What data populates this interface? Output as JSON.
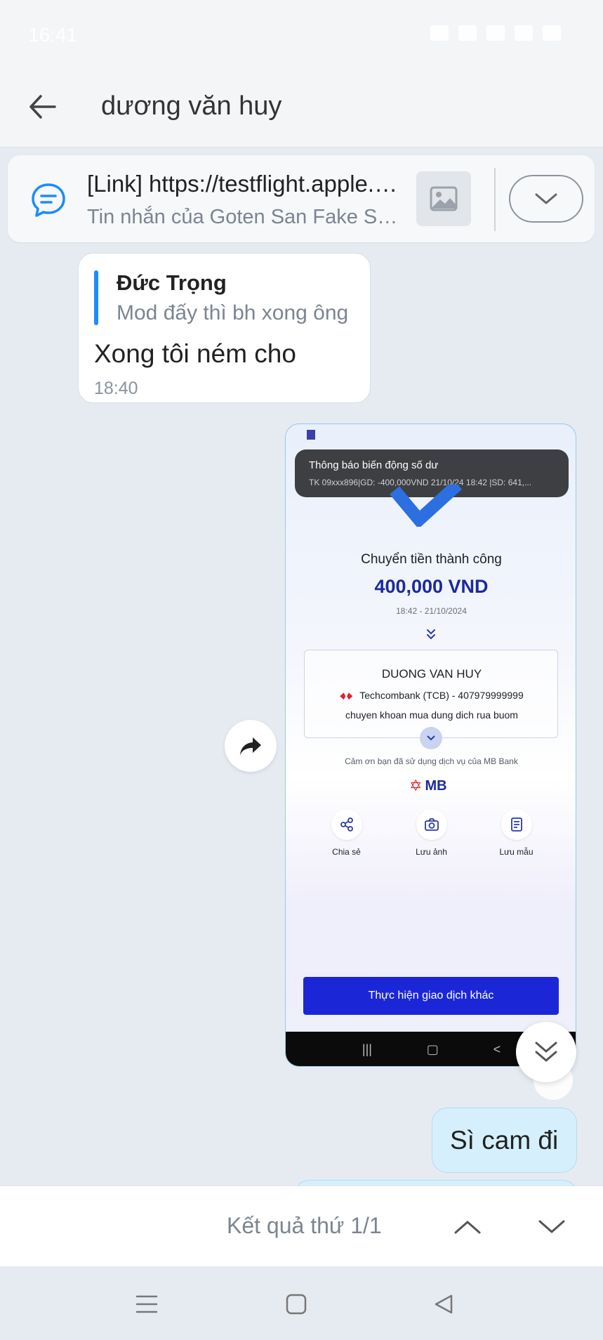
{
  "status_bar": {
    "time": "16:41"
  },
  "header": {
    "search_query": "dương văn huy"
  },
  "pinned": {
    "title": "[Link] https://testflight.apple.com/join/...",
    "subtitle": "Tin nhắn của Goten San Fake Scam"
  },
  "quoted_message": {
    "author": "Đức Trọng",
    "quote_text": "Mod đấy thì bh xong ông",
    "text": "Xong tôi ném cho",
    "time": "18:40"
  },
  "image_message": {
    "toast_title": "Thông báo biến động số dư",
    "toast_body": "TK 09xxx896|GD: -400,000VND 21/10/24 18:42 |SD: 641,...",
    "transfer_title": "Chuyển tiền thành công",
    "amount": "400,000 VND",
    "datetime": "18:42 - 21/10/2024",
    "recipient_name": "DUONG VAN HUY",
    "recipient_bank": "Techcombank (TCB) - 407979999999",
    "memo": "chuyen khoan mua dung dich rua buom",
    "thanks": "Cảm ơn bạn đã sử dụng dịch vụ của MB Bank",
    "logo_text": "MB",
    "actions": [
      {
        "label": "Chia sẻ",
        "icon": "share-icon"
      },
      {
        "label": "Lưu ảnh",
        "icon": "camera-icon"
      },
      {
        "label": "Lưu mẫu",
        "icon": "document-icon"
      }
    ],
    "cta": "Thực hiện giao dịch khác"
  },
  "outgoing_message": {
    "text": "Sì cam đi"
  },
  "search_results": {
    "label": "Kết quả thứ 1/1"
  },
  "colors": {
    "accent": "#1a8cff",
    "outgoing_bubble": "#d5f0fc",
    "mb_blue": "#1b27d6"
  }
}
